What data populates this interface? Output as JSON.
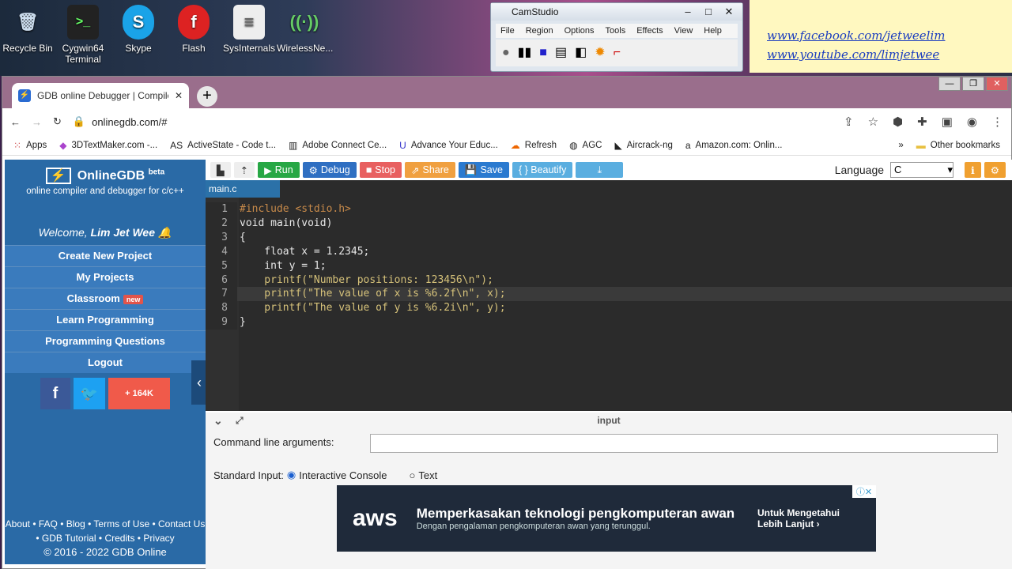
{
  "desktop": {
    "icons": [
      {
        "label": "Recycle Bin",
        "g": "🗑"
      },
      {
        "label": "Cygwin64 Terminal",
        "g": ">_"
      },
      {
        "label": "Skype",
        "g": "S"
      },
      {
        "label": "Flash",
        "g": "f"
      },
      {
        "label": "SysInternals",
        "g": "📄"
      },
      {
        "label": "WirelessNe...",
        "g": "📶"
      }
    ]
  },
  "camstudio": {
    "title": "CamStudio",
    "menu": [
      "File",
      "Region",
      "Options",
      "Tools",
      "Effects",
      "View",
      "Help"
    ]
  },
  "note": {
    "links": [
      "www.facebook.com/jetweelim",
      "www.youtube.com/limjetwee"
    ]
  },
  "browser": {
    "tab_title": "GDB online Debugger | Compile",
    "url": "onlinegdb.com/#",
    "bookmarks": [
      "Apps",
      "3DTextMaker.com -...",
      "ActiveState - Code t...",
      "Adobe Connect Ce...",
      "Advance Your Educ...",
      "Refresh",
      "AGC",
      "Aircrack-ng",
      "Amazon.com: Onlin..."
    ],
    "other_bookmarks": "Other bookmarks"
  },
  "sidebar": {
    "brand": "OnlineGDB",
    "beta": "beta",
    "tagline": "online compiler and debugger for c/c++",
    "welcome_prefix": "Welcome, ",
    "user": "Lim Jet Wee",
    "nav": [
      "Create New Project",
      "My Projects",
      "Classroom",
      "Learn Programming",
      "Programming Questions",
      "Logout"
    ],
    "new_badge": "new",
    "share_count": "164K",
    "footer_line1": "About • FAQ • Blog • Terms of Use • Contact Us",
    "footer_line2": "• GDB Tutorial • Credits • Privacy",
    "copyright": "© 2016 - 2022 GDB Online"
  },
  "toolbar": {
    "run": "Run",
    "debug": "Debug",
    "stop": "Stop",
    "share": "Share",
    "save": "Save",
    "beautify": "{ } Beautify",
    "language_label": "Language",
    "language_value": "C"
  },
  "editor": {
    "file": "main.c",
    "lines": [
      "#include <stdio.h>",
      "void main(void)",
      "{",
      "    float x = 1.2345;",
      "    int y = 1;",
      "    printf(\"Number positions: 123456\\n\");",
      "    printf(\"The value of x is %6.2f\\n\", x);",
      "    printf(\"The value of y is %6.2i\\n\", y);",
      "}"
    ]
  },
  "input": {
    "header": "input",
    "cmd_label": "Command line arguments:",
    "stdin_label": "Standard Input:",
    "opt1": "Interactive Console",
    "opt2": "Text"
  },
  "ad": {
    "brand": "aws",
    "headline": "Memperkasakan teknologi pengkomputeran awan",
    "sub": "Dengan pengalaman pengkomputeran awan yang terunggul.",
    "cta": "Untuk Mengetahui Lebih Lanjut ›"
  },
  "colors": {
    "sidebar": "#2a6aa6",
    "run": "#27a745",
    "debug": "#2f6fc2",
    "stop": "#e86060",
    "share": "#f0a040",
    "save": "#2a7ad0",
    "beautify": "#5aaee0"
  }
}
